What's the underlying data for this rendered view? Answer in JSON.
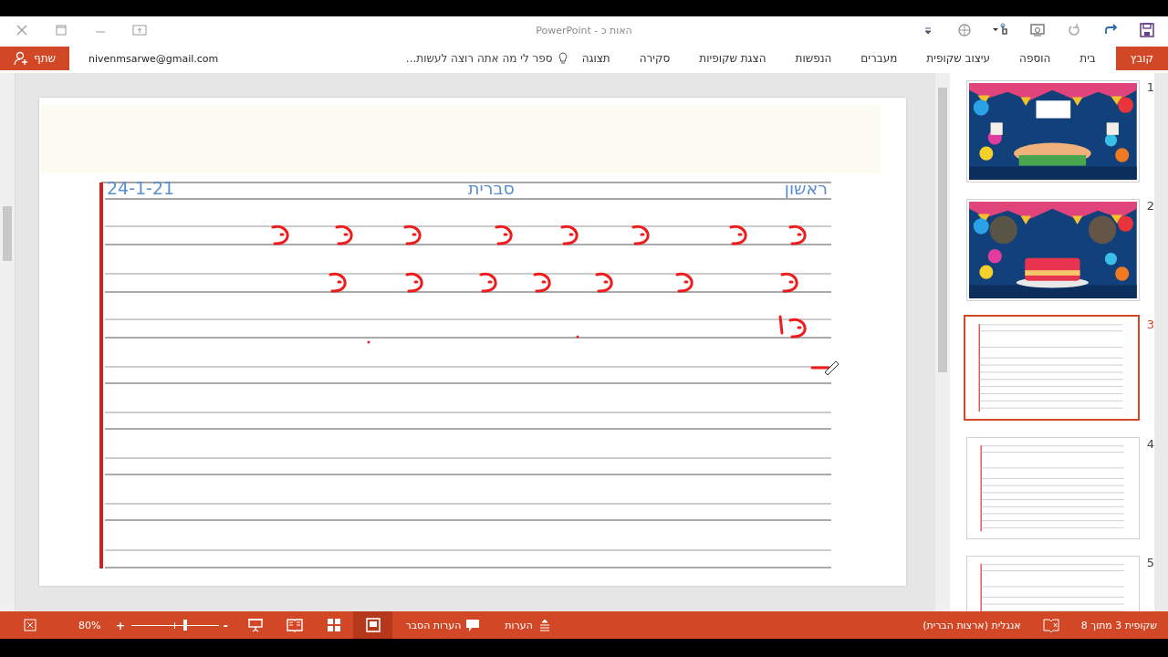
{
  "window": {
    "title": "האות כ - PowerPoint"
  },
  "ribbon_tabs": [
    {
      "label": "קובץ",
      "selected": true,
      "kind": "file"
    },
    {
      "label": "בית",
      "selected": false,
      "kind": "tab"
    },
    {
      "label": "הוספה",
      "selected": false,
      "kind": "tab"
    },
    {
      "label": "עיצוב שקופית",
      "selected": false,
      "kind": "tab"
    },
    {
      "label": "מעברים",
      "selected": false,
      "kind": "tab"
    },
    {
      "label": "הנפשות",
      "selected": false,
      "kind": "tab"
    },
    {
      "label": "הצגת שקופיות",
      "selected": false,
      "kind": "tab"
    },
    {
      "label": "סקירה",
      "selected": false,
      "kind": "tab"
    },
    {
      "label": "תצוגה",
      "selected": false,
      "kind": "tab"
    }
  ],
  "tell_me": {
    "placeholder": "ספר לי מה אתה רוצה לעשות..."
  },
  "account": "nivenmsarwe@gmail.com",
  "share_button": "שתף",
  "slide": {
    "header": [
      "ראשון",
      "סברית",
      "24-1-21"
    ]
  },
  "thumbnails": [
    {
      "number": "1",
      "kind": "picture",
      "selected": false
    },
    {
      "number": "2",
      "kind": "picture",
      "selected": false
    },
    {
      "number": "3",
      "kind": "lined",
      "selected": true
    },
    {
      "number": "4",
      "kind": "lined",
      "selected": false
    },
    {
      "number": "5",
      "kind": "lined",
      "selected": false
    }
  ],
  "status_bar": {
    "slide_count": "שקופית 3 מתוך 8",
    "language": "אנגלית (ארצות הברית)",
    "notes": "הערות",
    "comments": "הערות הסבר",
    "views": [
      {
        "kind": "normal",
        "selected": true
      },
      {
        "kind": "sorter",
        "selected": false
      },
      {
        "kind": "reading",
        "selected": false
      },
      {
        "kind": "slideshow",
        "selected": false
      }
    ],
    "zoom_minus": "-",
    "zoom_slider": {
      "level": 0.62
    },
    "zoom_plus": "+",
    "zoom": "80%"
  }
}
